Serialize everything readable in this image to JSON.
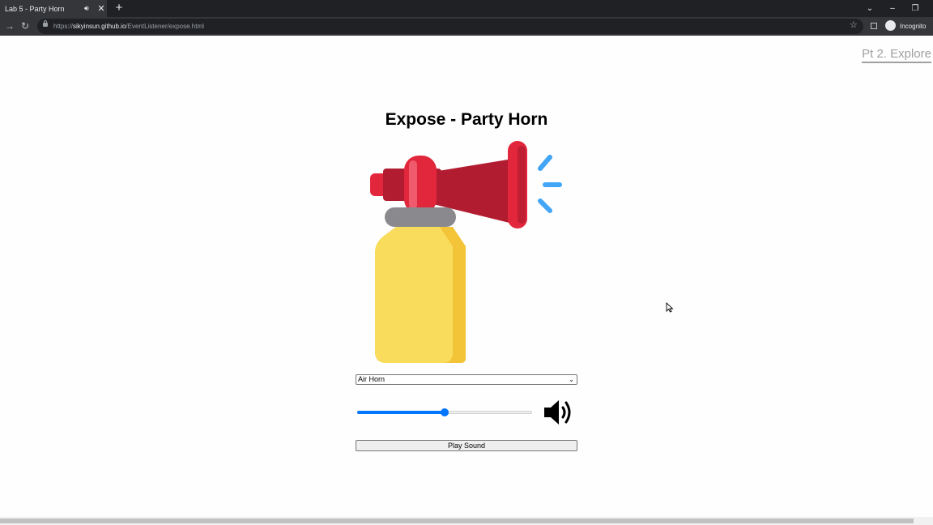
{
  "browser": {
    "tab_title": "Lab 5 - Party Horn",
    "new_tab": "+",
    "url_prefix": "https://",
    "url_host": "sikyinsun.github.io",
    "url_path": "/EventListener/expose.html",
    "profile_label": "Incognito"
  },
  "page": {
    "nav_link": "Pt 2. Explore",
    "title": "Expose - Party Horn",
    "sound_select": {
      "selected": "Air Horn"
    },
    "volume": {
      "value": 50,
      "min": 0,
      "max": 100
    },
    "play_button": "Play Sound"
  },
  "icons": {
    "horn_image": "air-horn-icon",
    "volume_icon": "volume-high-icon"
  },
  "colors": {
    "accent": "#0075ff",
    "horn_red": "#e2263c",
    "horn_yellow": "#f9dc5c",
    "sound_waves": "#42a5f5"
  }
}
